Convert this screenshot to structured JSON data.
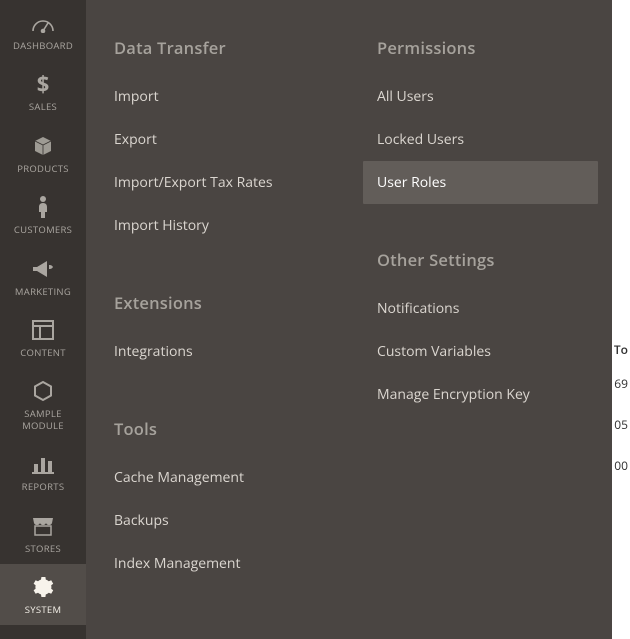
{
  "sidebar": {
    "items": [
      {
        "id": "dashboard",
        "label": "DASHBOARD",
        "icon": "gauge-icon"
      },
      {
        "id": "sales",
        "label": "SALES",
        "icon": "dollar-icon"
      },
      {
        "id": "products",
        "label": "PRODUCTS",
        "icon": "cube-icon"
      },
      {
        "id": "customers",
        "label": "CUSTOMERS",
        "icon": "person-icon"
      },
      {
        "id": "marketing",
        "label": "MARKETING",
        "icon": "megaphone-icon"
      },
      {
        "id": "content",
        "label": "CONTENT",
        "icon": "layout-icon"
      },
      {
        "id": "sample-module",
        "label": "SAMPLE MODULE",
        "icon": "hexagon-icon"
      },
      {
        "id": "reports",
        "label": "REPORTS",
        "icon": "bars-icon"
      },
      {
        "id": "stores",
        "label": "STORES",
        "icon": "storefront-icon"
      },
      {
        "id": "system",
        "label": "SYSTEM",
        "icon": "gear-icon"
      }
    ],
    "active": "system"
  },
  "flyout": {
    "columns": [
      {
        "sections": [
          {
            "title": "Data Transfer",
            "items": [
              "Import",
              "Export",
              "Import/Export Tax Rates",
              "Import History"
            ]
          },
          {
            "title": "Extensions",
            "items": [
              "Integrations"
            ]
          },
          {
            "title": "Tools",
            "items": [
              "Cache Management",
              "Backups",
              "Index Management"
            ]
          }
        ]
      },
      {
        "sections": [
          {
            "title": "Permissions",
            "items": [
              "All Users",
              "Locked Users",
              "User Roles"
            ],
            "selected": "User Roles"
          },
          {
            "title": "Other Settings",
            "items": [
              "Notifications",
              "Custom Variables",
              "Manage Encryption Key"
            ]
          }
        ]
      }
    ]
  },
  "peek": {
    "c0": "To",
    "c1": "69",
    "c2": "05",
    "c3": "00"
  }
}
